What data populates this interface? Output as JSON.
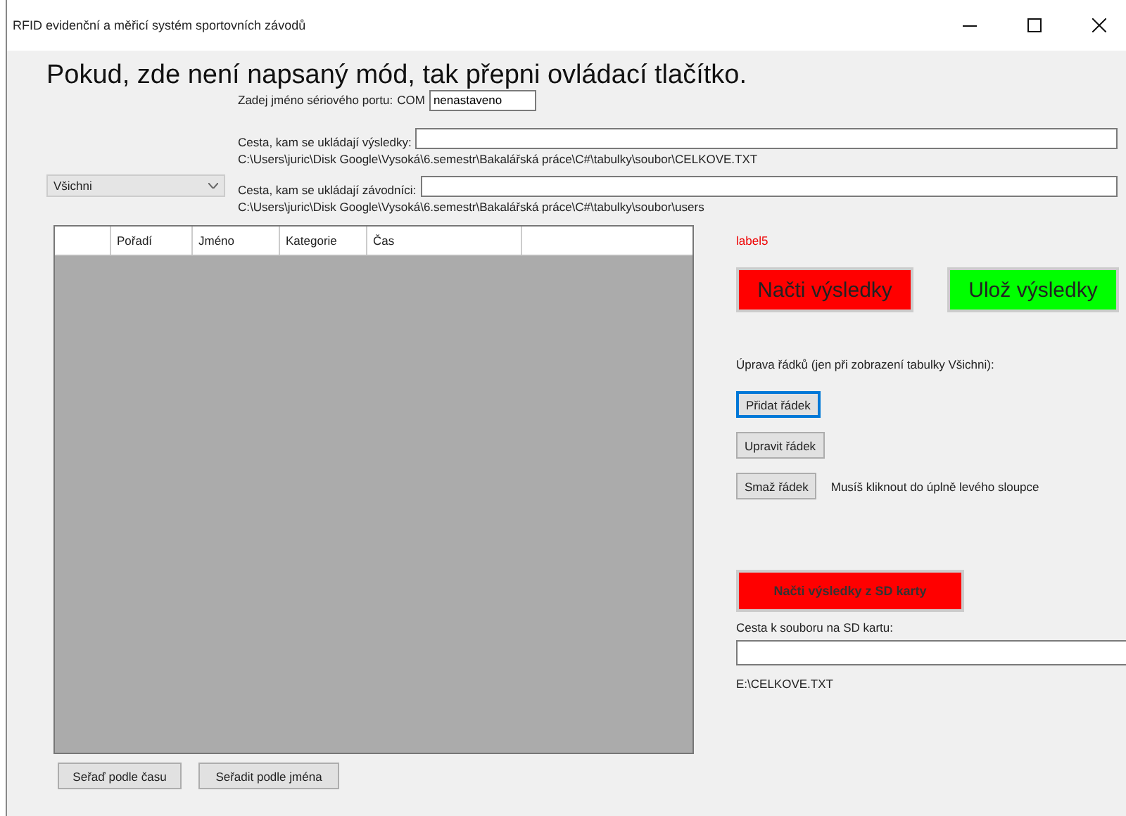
{
  "window": {
    "title": "RFID evidenční a měřicí systém sportovních závodů"
  },
  "heading": "Pokud, zde není napsaný mód, tak přepni ovládací tlačítko.",
  "port": {
    "label": "Zadej jméno sériového portu:",
    "prefix": "COM",
    "value": "nenastaveno"
  },
  "filter": {
    "value": "Všichni"
  },
  "paths": [
    {
      "label": "Cesta, kam se ukládají výsledky:",
      "path": "C:\\Users\\juric\\Disk Google\\Vysoká\\6.semestr\\Bakalářská práce\\C#\\tabulky\\soubor\\CELKOVE.TXT"
    },
    {
      "label": "Cesta, kam se ukládají závodníci:",
      "path": "C:\\Users\\juric\\Disk Google\\Vysoká\\6.semestr\\Bakalářská práce\\C#\\tabulky\\soubor\\users"
    }
  ],
  "table": {
    "columns": [
      "Pořadí",
      "Jméno",
      "Kategorie",
      "Čas"
    ]
  },
  "status_label": "label5",
  "main_buttons": [
    {
      "label": "Načti výsledky",
      "color": "#ff0000"
    },
    {
      "label": "Ulož výsledky",
      "color": "#00ff00"
    }
  ],
  "edit_caption": "Úprava řádků (jen při zobrazení tabulky Všichni):",
  "edit_buttons": [
    {
      "label": "Přidat řádek",
      "focused": true
    },
    {
      "label": "Upravit řádek",
      "focused": false
    },
    {
      "label": "Smaž řádek",
      "focused": false,
      "note": "Musíš kliknout do úplně levého sloupce"
    }
  ],
  "sd": {
    "button": "Načti výsledky z SD karty",
    "label": "Cesta k souboru na SD kartu:",
    "path": "E:\\CELKOVE.TXT"
  },
  "sort_buttons": [
    "Seřaď podle času",
    "Seřadit podle jména"
  ]
}
